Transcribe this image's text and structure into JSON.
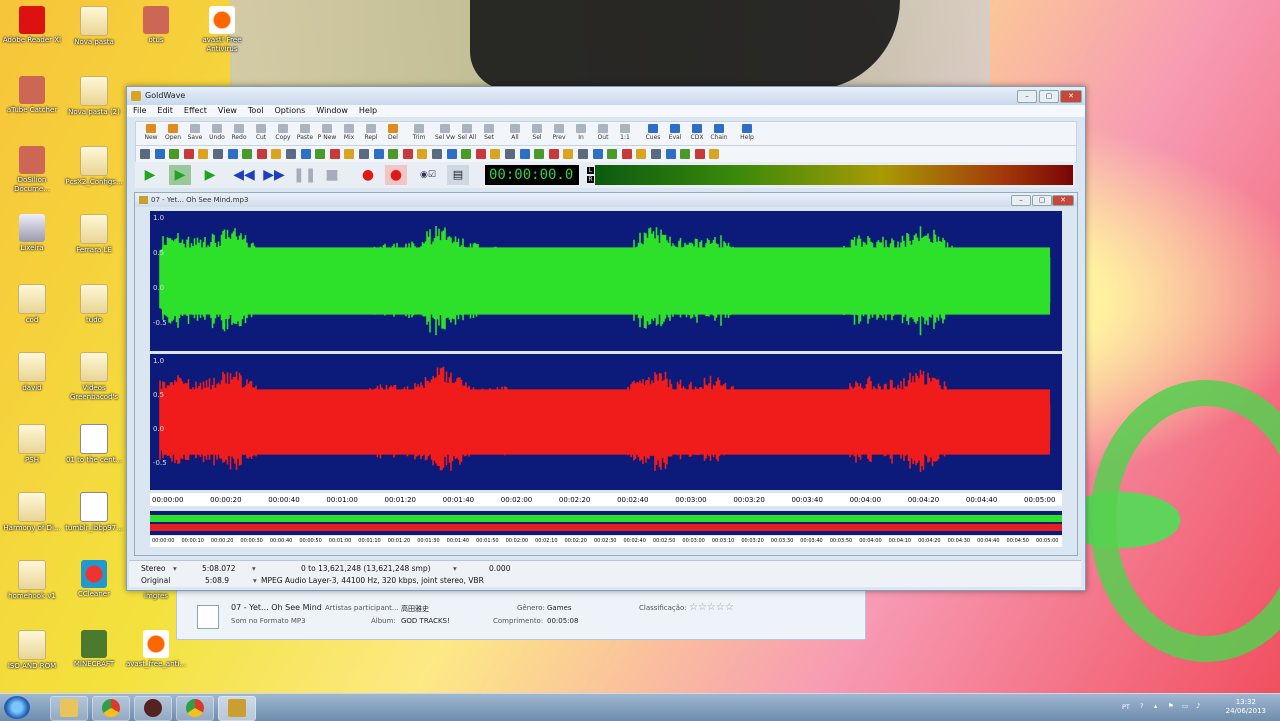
{
  "desktop": {
    "icons": [
      {
        "label": "Adobe Reader XI",
        "icon": "pdf-icon"
      },
      {
        "label": "Nova pasta",
        "icon": "folder-icon"
      },
      {
        "label": "otus",
        "icon": "app-icon"
      },
      {
        "label": "avast! Free Antivirus",
        "icon": "avast-icon"
      },
      {
        "label": "aTube Catcher",
        "icon": "app-icon"
      },
      {
        "label": "Nova pasta (2)",
        "icon": "folder-icon"
      },
      {
        "label": "DoSilion Docume...",
        "icon": "app-icon"
      },
      {
        "label": "PcsX2_Configs...",
        "icon": "folder-icon"
      },
      {
        "label": "Lixeira",
        "icon": "recycle-bin-icon"
      },
      {
        "label": "Ferrara LE",
        "icon": "folder-icon"
      },
      {
        "label": "cod",
        "icon": "folder-icon"
      },
      {
        "label": "tudo",
        "icon": "folder-icon"
      },
      {
        "label": "david",
        "icon": "folder-icon"
      },
      {
        "label": "Videos Greenbacod's",
        "icon": "folder-icon"
      },
      {
        "label": "PSH",
        "icon": "folder-icon"
      },
      {
        "label": "01 to the cent...",
        "icon": "document-icon"
      },
      {
        "label": "Harmony of Di...",
        "icon": "folder-icon"
      },
      {
        "label": "tumblr_lbbp97...",
        "icon": "document-icon"
      },
      {
        "label": "homehook v1",
        "icon": "folder-icon"
      },
      {
        "label": "CCleaner",
        "icon": "ccleaner-icon"
      },
      {
        "label": "imgres",
        "icon": "document-icon"
      },
      {
        "label": "ISO AND ROM",
        "icon": "folder-icon"
      },
      {
        "label": "MINECRAFT",
        "icon": "minecraft-icon"
      },
      {
        "label": "avast_free_anti...",
        "icon": "avast-icon"
      }
    ]
  },
  "details_pane": {
    "title": "07 - Yet... Oh See Mind",
    "subtitle": "Som no Formato MP3",
    "artists_label": "Artistas participant...",
    "artists_value": "高田雅史",
    "album_label": "Álbum:",
    "album_value": "GOD TRACKS!",
    "genre_label": "Gênero:",
    "genre_value": "Games",
    "length_label": "Comprimento:",
    "length_value": "00:05:08",
    "rating_label": "Classificação:",
    "rating_stars": "☆☆☆☆☆"
  },
  "window": {
    "title": "GoldWave",
    "menu": [
      "File",
      "Edit",
      "Effect",
      "View",
      "Tool",
      "Options",
      "Window",
      "Help"
    ],
    "toolbar": [
      "New",
      "Open",
      "Save",
      "Undo",
      "Redo",
      "Cut",
      "Copy",
      "Paste",
      "P New",
      "Mix",
      "Repl",
      "Del",
      "Trim",
      "Sel Vw",
      "Sel All",
      "Set",
      "All",
      "Sel",
      "Prev",
      "In",
      "Out",
      "1:1",
      "Cues",
      "Eval",
      "CDX",
      "Chain",
      "Help"
    ],
    "time_display": "00:00:00.0",
    "level_labels": [
      "L",
      "R"
    ]
  },
  "sound_window": {
    "title": "07 - Yet... Oh See Mind.mp3",
    "y_ticks": [
      "1.0",
      "0.5",
      "0.0",
      "-0.5"
    ],
    "ruler_ticks": [
      "00:00:00",
      "00:00:20",
      "00:00:40",
      "00:01:00",
      "00:01:20",
      "00:01:40",
      "00:02:00",
      "00:02:20",
      "00:02:40",
      "00:03:00",
      "00:03:20",
      "00:03:40",
      "00:04:00",
      "00:04:20",
      "00:04:40",
      "00:05:00"
    ],
    "overview_ticks": [
      "00:00:00",
      "00:00:10",
      "00:00:20",
      "00:00:30",
      "00:00:40",
      "00:00:50",
      "00:01:00",
      "00:01:10",
      "00:01:20",
      "00:01:30",
      "00:01:40",
      "00:01:50",
      "00:02:00",
      "00:02:10",
      "00:02:20",
      "00:02:30",
      "00:02:40",
      "00:02:50",
      "00:03:00",
      "00:03:10",
      "00:03:20",
      "00:03:30",
      "00:03:40",
      "00:03:50",
      "00:04:00",
      "00:04:10",
      "00:04:20",
      "00:04:30",
      "00:04:40",
      "00:04:50",
      "00:05:00"
    ]
  },
  "status": {
    "channel": "Stereo",
    "length": "5:08.072",
    "selection": "0 to 13,621,248 (13,621,248 smp)",
    "position": "0.000",
    "mode": "Original",
    "original_length": "5:08.9",
    "format": "MPEG Audio Layer-3, 44100 Hz, 320 kbps, joint stereo, VBR"
  },
  "taskbar": {
    "tray_lang": "PT",
    "time": "13:32",
    "date": "24/06/2013"
  }
}
